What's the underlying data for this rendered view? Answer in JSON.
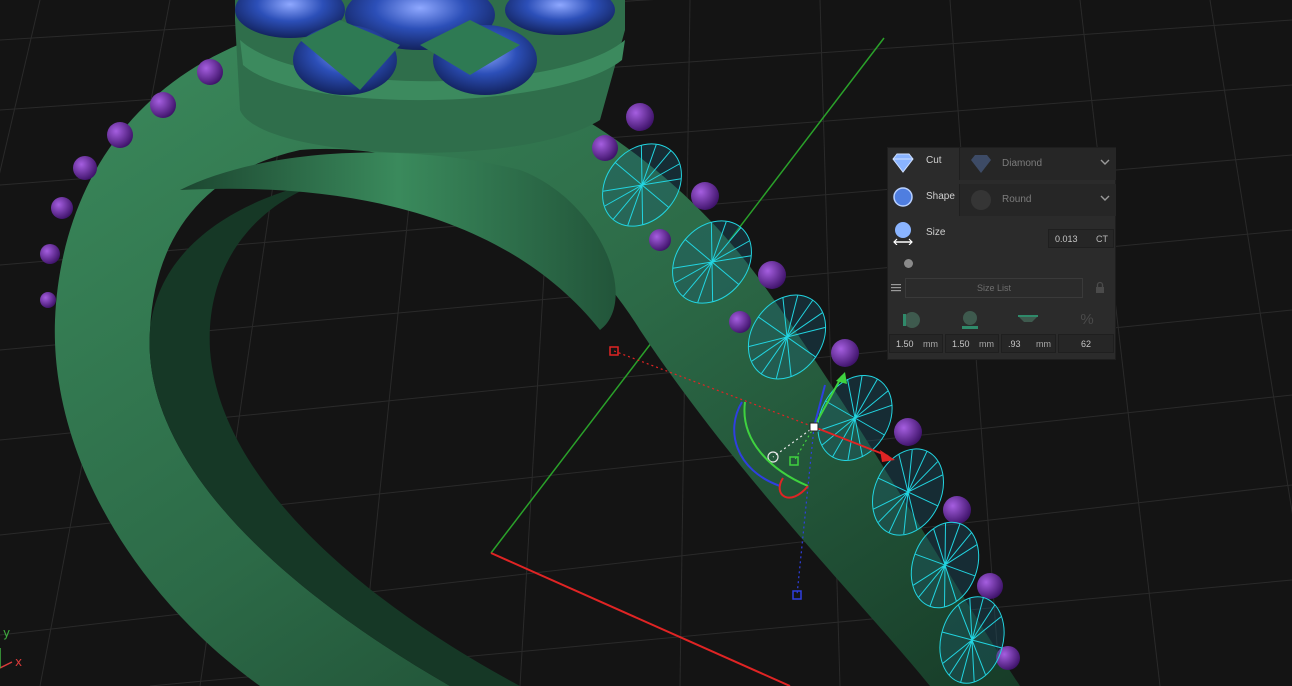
{
  "axes": {
    "y_label": "y",
    "x_label": "x"
  },
  "gem_panel": {
    "cut": {
      "label": "Cut",
      "value": "Diamond",
      "icon": "diamond-cut-icon"
    },
    "shape": {
      "label": "Shape",
      "value": "Round",
      "icon": "round-shape-icon"
    },
    "size": {
      "label": "Size",
      "value": "0.013",
      "unit": "CT",
      "icon": "size-icon"
    },
    "size_list": {
      "label": "Size List",
      "icon": "list-icon",
      "lock_icon": "lock-icon"
    },
    "dimensions": [
      {
        "icon": "diameter-icon",
        "value": "1.50",
        "unit": "mm"
      },
      {
        "icon": "width-icon",
        "value": "1.50",
        "unit": "mm"
      },
      {
        "icon": "depth-icon",
        "value": ".93",
        "unit": "mm"
      },
      {
        "icon": "percent-icon",
        "value": "62",
        "unit": ""
      }
    ],
    "percent_symbol": "%"
  },
  "colors": {
    "background": "#141414",
    "metal": "#2f6b4a",
    "gem_center": "#2a4fb5",
    "gem_wireframe": "#22d4e0",
    "beads": "#6a2a9a",
    "axis_x": "#d93a3a",
    "axis_y": "#3fae3f",
    "axis_z": "#2f3fe0",
    "panel_bg": "#2b2b2b"
  }
}
